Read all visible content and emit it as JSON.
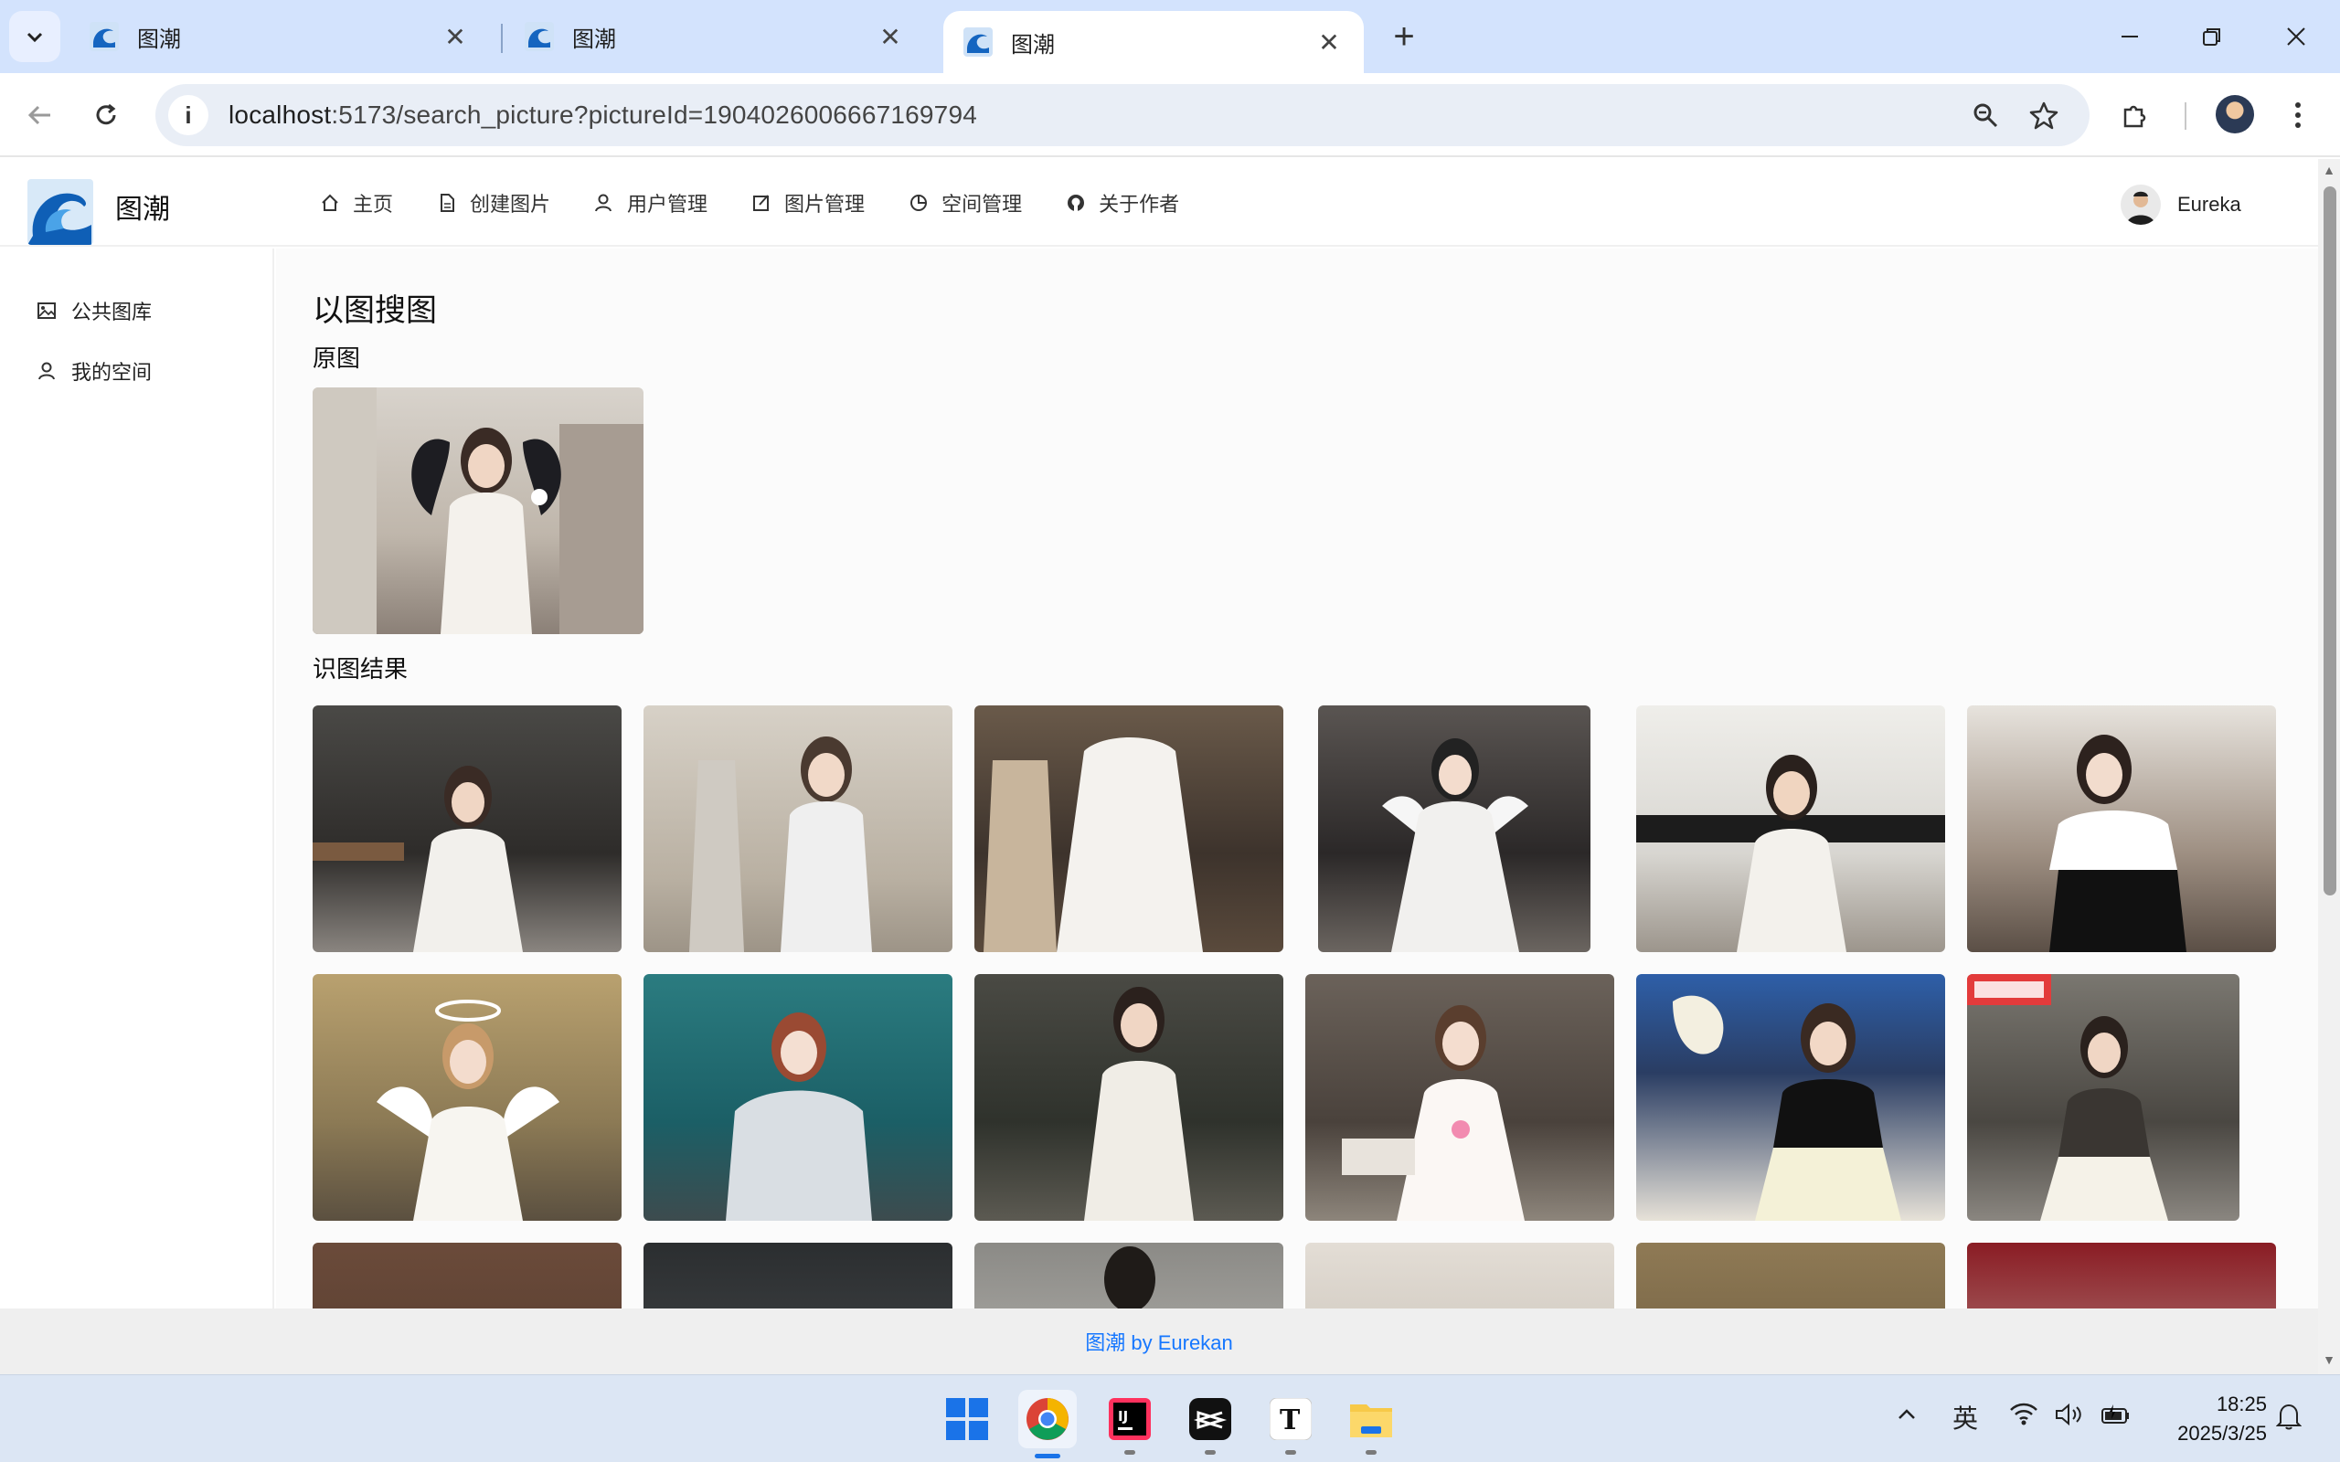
{
  "browser": {
    "tabs": [
      {
        "title": "图潮",
        "active": false
      },
      {
        "title": "图潮",
        "active": false
      },
      {
        "title": "图潮",
        "active": true
      }
    ],
    "url_host": "localhost",
    "url_rest": ":5173/search_picture?pictureId=1904026006667169794"
  },
  "header": {
    "site_title": "图潮",
    "nav": [
      {
        "label": "主页",
        "icon": "home-icon"
      },
      {
        "label": "创建图片",
        "icon": "file-icon"
      },
      {
        "label": "用户管理",
        "icon": "user-icon"
      },
      {
        "label": "图片管理",
        "icon": "edit-icon"
      },
      {
        "label": "空间管理",
        "icon": "pie-chart-icon"
      },
      {
        "label": "关于作者",
        "icon": "github-icon"
      }
    ],
    "user_name": "Eureka"
  },
  "sidebar": {
    "items": [
      {
        "label": "公共图库",
        "icon": "picture-icon"
      },
      {
        "label": "我的空间",
        "icon": "user-icon"
      }
    ]
  },
  "main": {
    "title": "以图搜图",
    "original_label": "原图",
    "results_label": "识图结果"
  },
  "footer": {
    "text": "图潮 by Eurekan"
  },
  "taskbar": {
    "ime": "英",
    "time": "18:25",
    "date": "2025/3/25"
  },
  "colors": {
    "accent": "#1677ff",
    "tabstrip": "#d3e3fd",
    "taskbar": "#dce6f4"
  }
}
